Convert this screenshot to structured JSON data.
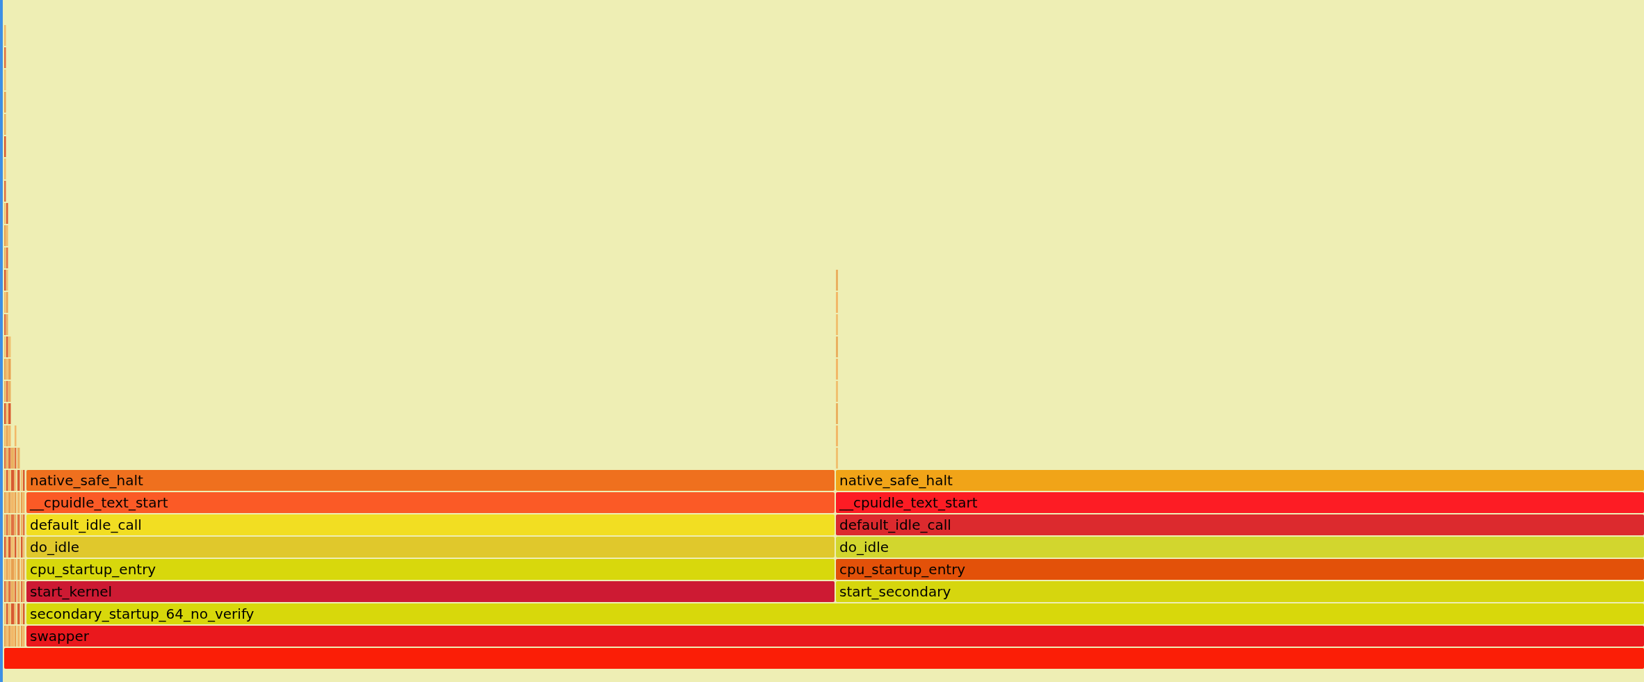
{
  "flame_graph": {
    "root": {
      "color": "#fb1e06",
      "children": [
        {
          "label": "swapper",
          "color": "#ea181d",
          "children": [
            {
              "label": "secondary_startup_64_no_verify",
              "color": "#d8d80b",
              "children": [
                {
                  "label": "start_kernel",
                  "color": "#cd1a33",
                  "children": [
                    {
                      "label": "cpu_startup_entry",
                      "color": "#d8d80c",
                      "children": [
                        {
                          "label": "do_idle",
                          "color": "#e0c82c",
                          "children": [
                            {
                              "label": "default_idle_call",
                              "color": "#f2de22",
                              "children": [
                                {
                                  "label": "__cpuidle_text_start",
                                  "color": "#fb5a26",
                                  "children": [
                                    {
                                      "label": "native_safe_halt",
                                      "color": "#ef701e"
                                    }
                                  ]
                                }
                              ]
                            }
                          ]
                        }
                      ]
                    }
                  ]
                },
                {
                  "label": "start_secondary",
                  "color": "#d6d60e",
                  "children": [
                    {
                      "label": "cpu_startup_entry",
                      "color": "#e35109",
                      "children": [
                        {
                          "label": "do_idle",
                          "color": "#d2d62e",
                          "children": [
                            {
                              "label": "default_idle_call",
                              "color": "#dc2a2e",
                              "children": [
                                {
                                  "label": "__cpuidle_text_start",
                                  "color": "#fd1c24",
                                  "children": [
                                    {
                                      "label": "native_safe_halt",
                                      "color": "#f1a418"
                                    }
                                  ]
                                }
                              ]
                            }
                          ]
                        }
                      ]
                    }
                  ]
                }
              ]
            }
          ]
        }
      ]
    }
  }
}
